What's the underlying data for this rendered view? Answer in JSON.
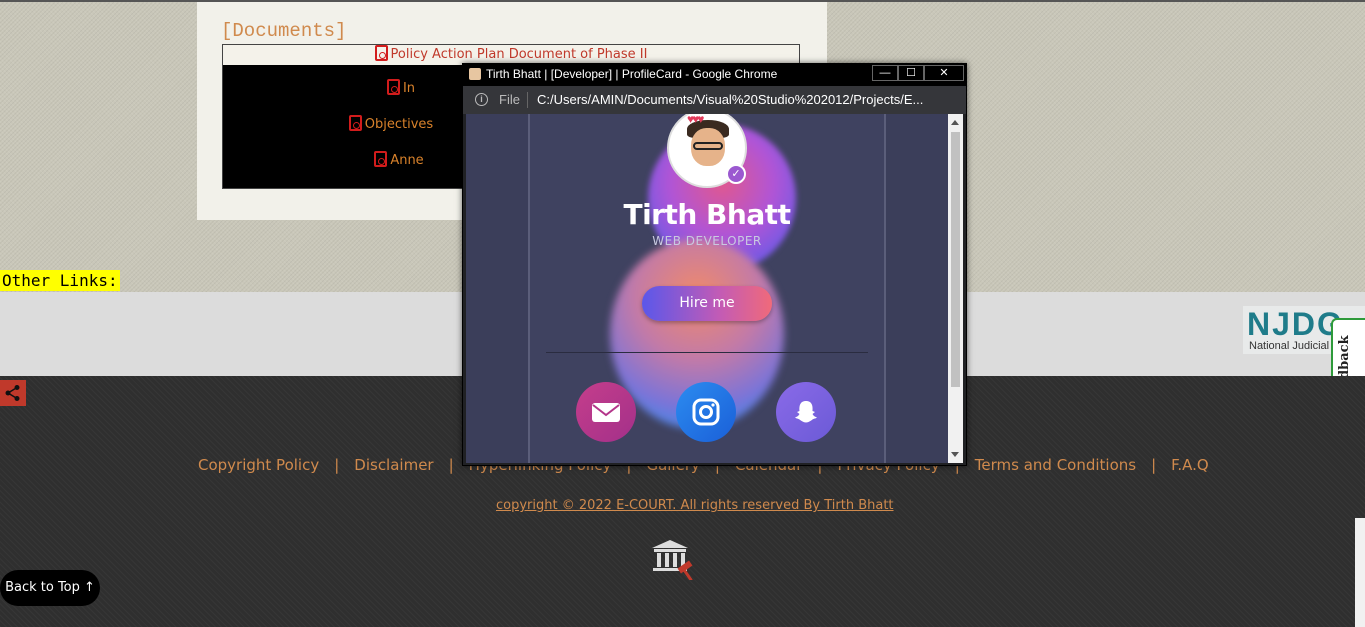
{
  "documents": {
    "title": "[Documents]",
    "items": [
      "Policy Action Plan Document of Phase II",
      "In",
      "Objectives",
      "Anne"
    ]
  },
  "other_links_label": "Other Links:",
  "njdg": {
    "logo_text": "NJDG",
    "subtext": "National Judicial"
  },
  "feedback_label": "Feedback",
  "footer": {
    "links": [
      "Copyright Policy",
      "Disclaimer",
      "Hyperlinking Policy",
      "Gallery",
      "Calendar",
      "Privacy Policy",
      "Terms and Conditions",
      "F.A.Q"
    ],
    "copyright": "copyright © 2022 E-COURT. All rights reserved By Tirth Bhatt"
  },
  "back_to_top": "Back to Top ↑",
  "popup": {
    "window_title": "Tirth Bhatt | [Developer] | ProfileCard - Google Chrome",
    "controls": {
      "minimize": "—",
      "maximize": "☐",
      "close": "✕"
    },
    "address_scheme": "File",
    "url": "C:/Users/AMIN/Documents/Visual%20Studio%202012/Projects/E...",
    "profile": {
      "name": "Tirth Bhatt",
      "role": "WEB DEVELOPER",
      "hire_button": "Hire me"
    },
    "social_icons": [
      "mail-icon",
      "instagram-icon",
      "snapchat-icon"
    ]
  },
  "colors": {
    "accent_orange": "#d08a4d",
    "footer_bg": "#2f2f2f",
    "card_bg": "#3f4260",
    "hire_gradient": [
      "#5a57ea",
      "#f06a7a"
    ]
  }
}
